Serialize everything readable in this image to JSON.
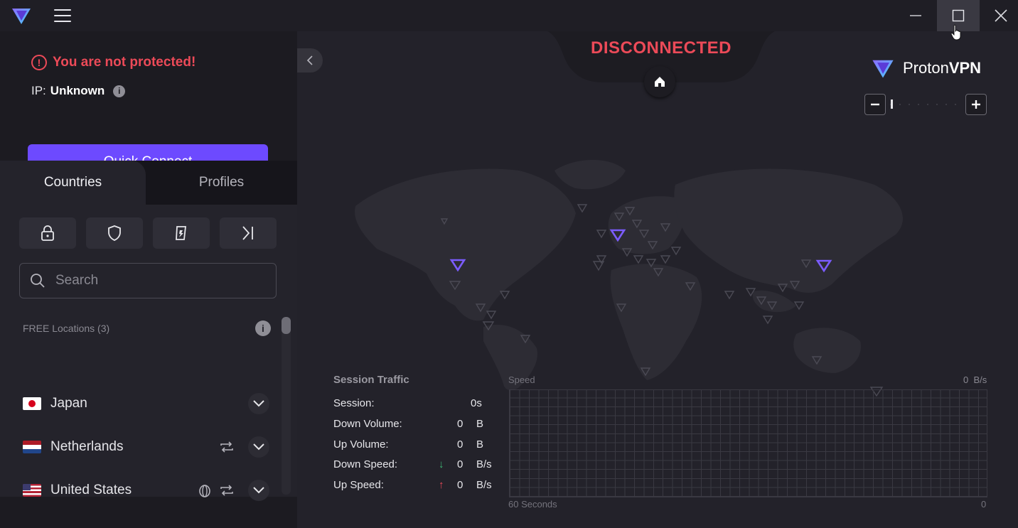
{
  "window": {
    "logo_icon": "protonvpn-logo",
    "menu_icon": "hamburger-icon",
    "controls": [
      "minimize-icon",
      "maximize-icon",
      "close-icon"
    ]
  },
  "status": {
    "warning": "You are not protected!",
    "ip_label": "IP:",
    "ip_value": "Unknown",
    "connection": "DISCONNECTED"
  },
  "sidebar": {
    "quick_connect": "Quick Connect",
    "tabs": [
      {
        "label": "Countries",
        "active": true
      },
      {
        "label": "Profiles",
        "active": false
      }
    ],
    "filters": [
      "lock-icon",
      "shield-icon",
      "secure-core-icon",
      "tor-icon"
    ],
    "search_placeholder": "Search",
    "free_header": "FREE Locations (3)",
    "countries": [
      {
        "name": "Japan",
        "flag": "JP",
        "icons": []
      },
      {
        "name": "Netherlands",
        "flag": "NL",
        "icons": [
          "p2p-icon"
        ]
      },
      {
        "name": "United States",
        "flag": "US",
        "icons": [
          "tor-icon",
          "p2p-icon"
        ]
      }
    ]
  },
  "main": {
    "brand": {
      "proton": "Proton",
      "vpn": "VPN"
    },
    "zoom": {
      "minus": "−",
      "plus": "+"
    },
    "traffic": {
      "title": "Session Traffic",
      "rows": [
        {
          "label": "Session:",
          "value": "0s",
          "unit": ""
        },
        {
          "label": "Down Volume:",
          "value": "0",
          "unit": "B"
        },
        {
          "label": "Up Volume:",
          "value": "0",
          "unit": "B"
        },
        {
          "label": "Down Speed:",
          "value": "0",
          "unit": "B/s",
          "arrow": "↓"
        },
        {
          "label": "Up Speed:",
          "value": "0",
          "unit": "B/s",
          "arrow": "↑"
        }
      ]
    },
    "graph": {
      "label": "Speed",
      "value": "0  B/s",
      "x_left": "60 Seconds",
      "x_right": "0"
    }
  },
  "colors": {
    "accent": "#6d4aff",
    "danger": "#ec4a58",
    "down_arrow": "#3fb876",
    "up_arrow": "#ec4a58"
  }
}
